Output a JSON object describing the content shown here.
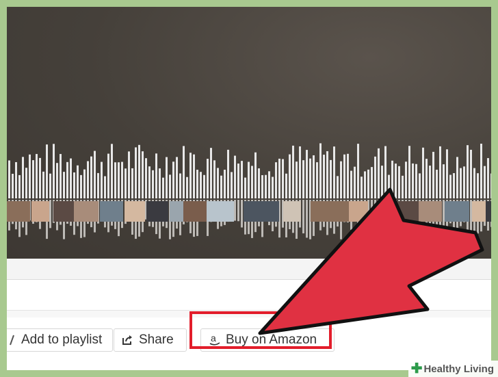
{
  "actions": {
    "add_to_playlist": "Add to playlist",
    "share": "Share",
    "buy_on_amazon": "Buy on Amazon"
  },
  "watermark": {
    "text": "Healthy Living"
  },
  "colors": {
    "frame_border": "#a8c98f",
    "player_background": "#45403a",
    "waveform_bar": "#e8e8e8",
    "highlight_red": "#e21d2b",
    "arrow_red": "#e03142",
    "watermark_green": "#2d9b4b"
  },
  "icons": {
    "playlist": "playlist-icon",
    "share": "share-icon",
    "amazon": "amazon-logo-icon",
    "watermark": "plus-cross-icon"
  }
}
